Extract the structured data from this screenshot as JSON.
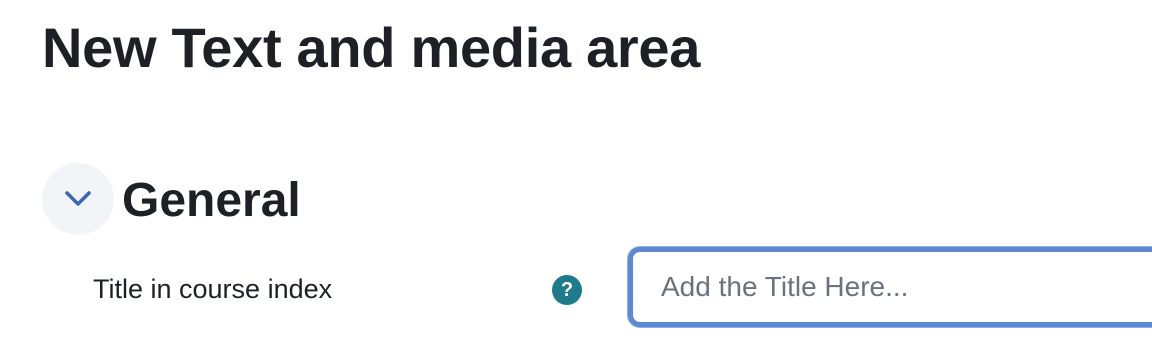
{
  "page": {
    "title": "New Text and media area"
  },
  "section": {
    "heading": "General",
    "expanded": true,
    "toggle_icon": "chevron-down-icon",
    "accent_color": "#3c67b5"
  },
  "form": {
    "title_field": {
      "label": "Title in course index",
      "help_icon": "question-mark-icon",
      "help_symbol": "?",
      "placeholder": "Add the Title Here...",
      "value": ""
    }
  },
  "colors": {
    "text": "#1d2125",
    "help_icon_bg": "#1f7a8c",
    "input_focus_border": "#5e88cf",
    "toggle_bg": "#f2f4f8"
  }
}
